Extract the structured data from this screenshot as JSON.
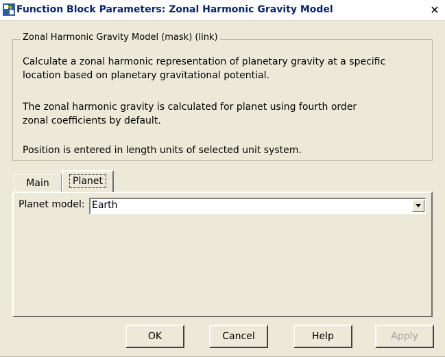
{
  "window": {
    "title": "Function Block Parameters: Zonal Harmonic Gravity Model",
    "close_label": "✕"
  },
  "group": {
    "legend": "Zonal Harmonic Gravity Model (mask) (link)",
    "description_lines": [
      "Calculate a zonal harmonic representation of planetary gravity at a specific",
      "location based on planetary gravitational potential.",
      "The zonal harmonic gravity is calculated for planet using fourth order",
      "zonal coefficients by default.",
      "Position is entered in length units of selected unit system."
    ]
  },
  "tabs": [
    {
      "label": "Main",
      "active": false
    },
    {
      "label": "Planet",
      "active": true
    }
  ],
  "planet_tab": {
    "planet_model_label": "Planet model:",
    "planet_model_value": "Earth"
  },
  "buttons": {
    "ok": "OK",
    "cancel": "Cancel",
    "help": "Help",
    "apply": "Apply"
  },
  "icons": {
    "title_icon": "simulink-block-icon",
    "dropdown_icon": "chevron-down-icon"
  }
}
